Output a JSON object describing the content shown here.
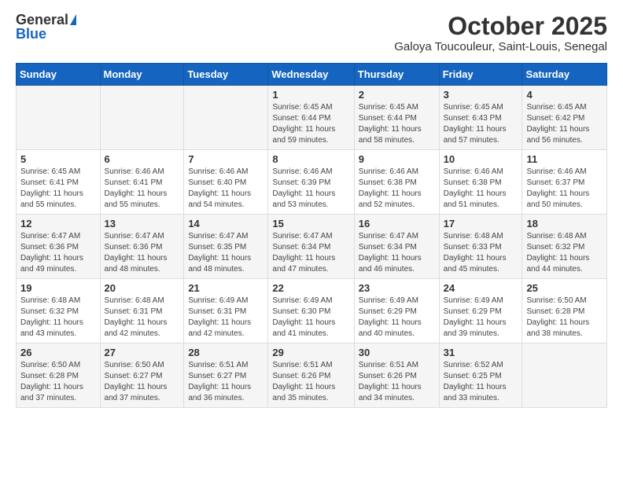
{
  "header": {
    "logo_general": "General",
    "logo_blue": "Blue",
    "month_year": "October 2025",
    "location": "Galoya Toucouleur, Saint-Louis, Senegal"
  },
  "weekdays": [
    "Sunday",
    "Monday",
    "Tuesday",
    "Wednesday",
    "Thursday",
    "Friday",
    "Saturday"
  ],
  "weeks": [
    [
      {
        "day": "",
        "info": ""
      },
      {
        "day": "",
        "info": ""
      },
      {
        "day": "",
        "info": ""
      },
      {
        "day": "1",
        "info": "Sunrise: 6:45 AM\nSunset: 6:44 PM\nDaylight: 11 hours\nand 59 minutes."
      },
      {
        "day": "2",
        "info": "Sunrise: 6:45 AM\nSunset: 6:44 PM\nDaylight: 11 hours\nand 58 minutes."
      },
      {
        "day": "3",
        "info": "Sunrise: 6:45 AM\nSunset: 6:43 PM\nDaylight: 11 hours\nand 57 minutes."
      },
      {
        "day": "4",
        "info": "Sunrise: 6:45 AM\nSunset: 6:42 PM\nDaylight: 11 hours\nand 56 minutes."
      }
    ],
    [
      {
        "day": "5",
        "info": "Sunrise: 6:45 AM\nSunset: 6:41 PM\nDaylight: 11 hours\nand 55 minutes."
      },
      {
        "day": "6",
        "info": "Sunrise: 6:46 AM\nSunset: 6:41 PM\nDaylight: 11 hours\nand 55 minutes."
      },
      {
        "day": "7",
        "info": "Sunrise: 6:46 AM\nSunset: 6:40 PM\nDaylight: 11 hours\nand 54 minutes."
      },
      {
        "day": "8",
        "info": "Sunrise: 6:46 AM\nSunset: 6:39 PM\nDaylight: 11 hours\nand 53 minutes."
      },
      {
        "day": "9",
        "info": "Sunrise: 6:46 AM\nSunset: 6:38 PM\nDaylight: 11 hours\nand 52 minutes."
      },
      {
        "day": "10",
        "info": "Sunrise: 6:46 AM\nSunset: 6:38 PM\nDaylight: 11 hours\nand 51 minutes."
      },
      {
        "day": "11",
        "info": "Sunrise: 6:46 AM\nSunset: 6:37 PM\nDaylight: 11 hours\nand 50 minutes."
      }
    ],
    [
      {
        "day": "12",
        "info": "Sunrise: 6:47 AM\nSunset: 6:36 PM\nDaylight: 11 hours\nand 49 minutes."
      },
      {
        "day": "13",
        "info": "Sunrise: 6:47 AM\nSunset: 6:36 PM\nDaylight: 11 hours\nand 48 minutes."
      },
      {
        "day": "14",
        "info": "Sunrise: 6:47 AM\nSunset: 6:35 PM\nDaylight: 11 hours\nand 48 minutes."
      },
      {
        "day": "15",
        "info": "Sunrise: 6:47 AM\nSunset: 6:34 PM\nDaylight: 11 hours\nand 47 minutes."
      },
      {
        "day": "16",
        "info": "Sunrise: 6:47 AM\nSunset: 6:34 PM\nDaylight: 11 hours\nand 46 minutes."
      },
      {
        "day": "17",
        "info": "Sunrise: 6:48 AM\nSunset: 6:33 PM\nDaylight: 11 hours\nand 45 minutes."
      },
      {
        "day": "18",
        "info": "Sunrise: 6:48 AM\nSunset: 6:32 PM\nDaylight: 11 hours\nand 44 minutes."
      }
    ],
    [
      {
        "day": "19",
        "info": "Sunrise: 6:48 AM\nSunset: 6:32 PM\nDaylight: 11 hours\nand 43 minutes."
      },
      {
        "day": "20",
        "info": "Sunrise: 6:48 AM\nSunset: 6:31 PM\nDaylight: 11 hours\nand 42 minutes."
      },
      {
        "day": "21",
        "info": "Sunrise: 6:49 AM\nSunset: 6:31 PM\nDaylight: 11 hours\nand 42 minutes."
      },
      {
        "day": "22",
        "info": "Sunrise: 6:49 AM\nSunset: 6:30 PM\nDaylight: 11 hours\nand 41 minutes."
      },
      {
        "day": "23",
        "info": "Sunrise: 6:49 AM\nSunset: 6:29 PM\nDaylight: 11 hours\nand 40 minutes."
      },
      {
        "day": "24",
        "info": "Sunrise: 6:49 AM\nSunset: 6:29 PM\nDaylight: 11 hours\nand 39 minutes."
      },
      {
        "day": "25",
        "info": "Sunrise: 6:50 AM\nSunset: 6:28 PM\nDaylight: 11 hours\nand 38 minutes."
      }
    ],
    [
      {
        "day": "26",
        "info": "Sunrise: 6:50 AM\nSunset: 6:28 PM\nDaylight: 11 hours\nand 37 minutes."
      },
      {
        "day": "27",
        "info": "Sunrise: 6:50 AM\nSunset: 6:27 PM\nDaylight: 11 hours\nand 37 minutes."
      },
      {
        "day": "28",
        "info": "Sunrise: 6:51 AM\nSunset: 6:27 PM\nDaylight: 11 hours\nand 36 minutes."
      },
      {
        "day": "29",
        "info": "Sunrise: 6:51 AM\nSunset: 6:26 PM\nDaylight: 11 hours\nand 35 minutes."
      },
      {
        "day": "30",
        "info": "Sunrise: 6:51 AM\nSunset: 6:26 PM\nDaylight: 11 hours\nand 34 minutes."
      },
      {
        "day": "31",
        "info": "Sunrise: 6:52 AM\nSunset: 6:25 PM\nDaylight: 11 hours\nand 33 minutes."
      },
      {
        "day": "",
        "info": ""
      }
    ]
  ]
}
